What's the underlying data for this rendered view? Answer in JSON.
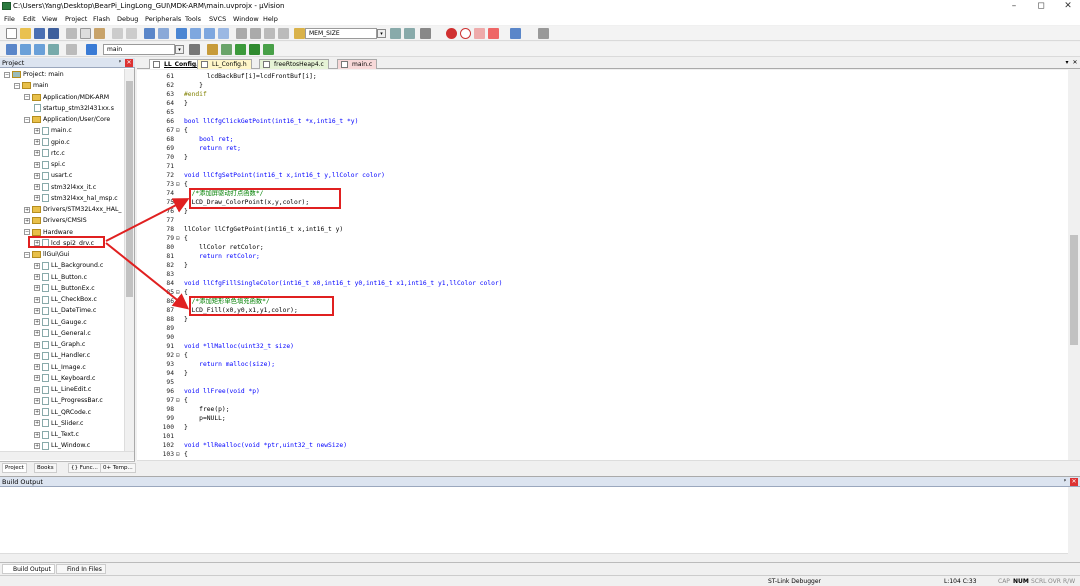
{
  "window": {
    "title": "C:\\Users\\Yang\\Desktop\\BearPi_LingLong_GUI\\MDK-ARM\\main.uvprojx - µVision",
    "minimize": "–",
    "maximize": "◻",
    "close": "✕"
  },
  "menu": [
    "File",
    "Edit",
    "View",
    "Project",
    "Flash",
    "Debug",
    "Peripherals",
    "Tools",
    "SVCS",
    "Window",
    "Help"
  ],
  "toolbar": {
    "find_combo": "MEM_SIZE",
    "target_combo": "main"
  },
  "project_panel": {
    "title": "Project",
    "close": "✕",
    "pin": "ᵖ",
    "items": [
      {
        "label": "Project: main",
        "indent": 0,
        "type": "root",
        "exp": "⊟"
      },
      {
        "label": "main",
        "indent": 1,
        "type": "target",
        "exp": "⊟"
      },
      {
        "label": "Application/MDK-ARM",
        "indent": 2,
        "type": "folder",
        "exp": "⊟"
      },
      {
        "label": "startup_stm32l431xx.s",
        "indent": 3,
        "type": "file",
        "exp": ""
      },
      {
        "label": "Application/User/Core",
        "indent": 2,
        "type": "folder",
        "exp": "⊟"
      },
      {
        "label": "main.c",
        "indent": 3,
        "type": "file",
        "exp": "⊞"
      },
      {
        "label": "gpio.c",
        "indent": 3,
        "type": "file",
        "exp": "⊞"
      },
      {
        "label": "rtc.c",
        "indent": 3,
        "type": "file",
        "exp": "⊞"
      },
      {
        "label": "spi.c",
        "indent": 3,
        "type": "file",
        "exp": "⊞"
      },
      {
        "label": "usart.c",
        "indent": 3,
        "type": "file",
        "exp": "⊞"
      },
      {
        "label": "stm32l4xx_it.c",
        "indent": 3,
        "type": "file",
        "exp": "⊞"
      },
      {
        "label": "stm32l4xx_hal_msp.c",
        "indent": 3,
        "type": "file",
        "exp": "⊞"
      },
      {
        "label": "Drivers/STM32L4xx_HAL_",
        "indent": 2,
        "type": "folder",
        "exp": "⊞"
      },
      {
        "label": "Drivers/CMSIS",
        "indent": 2,
        "type": "folder",
        "exp": "⊞"
      },
      {
        "label": "Hardware",
        "indent": 2,
        "type": "folder",
        "exp": "⊟"
      },
      {
        "label": "lcd_spi2_drv.c",
        "indent": 3,
        "type": "file",
        "exp": "⊞"
      },
      {
        "label": "llGui\\Gui",
        "indent": 2,
        "type": "folder",
        "exp": "⊟"
      },
      {
        "label": "LL_Background.c",
        "indent": 3,
        "type": "file",
        "exp": "⊞"
      },
      {
        "label": "LL_Button.c",
        "indent": 3,
        "type": "file",
        "exp": "⊞"
      },
      {
        "label": "LL_ButtonEx.c",
        "indent": 3,
        "type": "file",
        "exp": "⊞"
      },
      {
        "label": "LL_CheckBox.c",
        "indent": 3,
        "type": "file",
        "exp": "⊞"
      },
      {
        "label": "LL_DateTime.c",
        "indent": 3,
        "type": "file",
        "exp": "⊞"
      },
      {
        "label": "LL_Gauge.c",
        "indent": 3,
        "type": "file",
        "exp": "⊞"
      },
      {
        "label": "LL_General.c",
        "indent": 3,
        "type": "file",
        "exp": "⊞"
      },
      {
        "label": "LL_Graph.c",
        "indent": 3,
        "type": "file",
        "exp": "⊞"
      },
      {
        "label": "LL_Handler.c",
        "indent": 3,
        "type": "file",
        "exp": "⊞"
      },
      {
        "label": "LL_Image.c",
        "indent": 3,
        "type": "file",
        "exp": "⊞"
      },
      {
        "label": "LL_Keyboard.c",
        "indent": 3,
        "type": "file",
        "exp": "⊞"
      },
      {
        "label": "LL_LineEdit.c",
        "indent": 3,
        "type": "file",
        "exp": "⊞"
      },
      {
        "label": "LL_ProgressBar.c",
        "indent": 3,
        "type": "file",
        "exp": "⊞"
      },
      {
        "label": "LL_QRCode.c",
        "indent": 3,
        "type": "file",
        "exp": "⊞"
      },
      {
        "label": "LL_Slider.c",
        "indent": 3,
        "type": "file",
        "exp": "⊞"
      },
      {
        "label": "LL_Text.c",
        "indent": 3,
        "type": "file",
        "exp": "⊞"
      },
      {
        "label": "LL_Window.c",
        "indent": 3,
        "type": "file",
        "exp": "⊞"
      }
    ],
    "bottom_tabs": [
      "Project",
      "Books",
      "{} Func...",
      "0+ Temp..."
    ]
  },
  "editor_tabs": [
    {
      "label": "LL_Config.c",
      "active": true,
      "color": "#ffffff"
    },
    {
      "label": "LL_Config.h",
      "active": false,
      "color": "#fff6c8"
    },
    {
      "label": "freeRtosHeap4.c",
      "active": false,
      "color": "#e6f3d6"
    },
    {
      "label": "main.c",
      "active": false,
      "color": "#f7d8d8"
    }
  ],
  "code_lines": [
    {
      "n": "61",
      "f": "",
      "t": "      lcdBackBuf[i]=lcdFrontBuf[i];",
      "c": "n"
    },
    {
      "n": "62",
      "f": "",
      "t": "    }",
      "c": "n"
    },
    {
      "n": "63",
      "f": "",
      "t": "#endif",
      "c": "pp"
    },
    {
      "n": "64",
      "f": "",
      "t": "}",
      "c": "n"
    },
    {
      "n": "65",
      "f": "",
      "t": "",
      "c": "n"
    },
    {
      "n": "66",
      "f": "",
      "t": "bool llCfgClickGetPoint(int16_t *x,int16_t *y)",
      "c": "fn"
    },
    {
      "n": "67",
      "f": "⊟",
      "t": "{",
      "c": "n"
    },
    {
      "n": "68",
      "f": "",
      "t": "    bool ret;",
      "c": "kwl"
    },
    {
      "n": "69",
      "f": "",
      "t": "    return ret;",
      "c": "kwl"
    },
    {
      "n": "70",
      "f": "",
      "t": "}",
      "c": "n"
    },
    {
      "n": "71",
      "f": "",
      "t": "",
      "c": "n"
    },
    {
      "n": "72",
      "f": "",
      "t": "void llCfgSetPoint(int16_t x,int16_t y,llColor color)",
      "c": "fn"
    },
    {
      "n": "73",
      "f": "⊟",
      "t": "{",
      "c": "n"
    },
    {
      "n": "74",
      "f": "",
      "t": "  /*添加屏驱动打点函数*/",
      "c": "cm"
    },
    {
      "n": "75",
      "f": "",
      "t": "  LCD_Draw_ColorPoint(x,y,color);",
      "c": "n"
    },
    {
      "n": "76",
      "f": "",
      "t": "}",
      "c": "n"
    },
    {
      "n": "77",
      "f": "",
      "t": "",
      "c": "n"
    },
    {
      "n": "78",
      "f": "",
      "t": "llColor llCfgGetPoint(int16_t x,int16_t y)",
      "c": "n"
    },
    {
      "n": "79",
      "f": "⊟",
      "t": "{",
      "c": "n"
    },
    {
      "n": "80",
      "f": "",
      "t": "    llColor retColor;",
      "c": "n"
    },
    {
      "n": "81",
      "f": "",
      "t": "    return retColor;",
      "c": "kwl"
    },
    {
      "n": "82",
      "f": "",
      "t": "}",
      "c": "n"
    },
    {
      "n": "83",
      "f": "",
      "t": "",
      "c": "n"
    },
    {
      "n": "84",
      "f": "",
      "t": "void llCfgFillSingleColor(int16_t x0,int16_t y0,int16_t x1,int16_t y1,llColor color)",
      "c": "fn"
    },
    {
      "n": "85",
      "f": "⊟",
      "t": "{",
      "c": "n"
    },
    {
      "n": "86",
      "f": "",
      "t": "  /*添加矩形单色填充函数*/",
      "c": "cm"
    },
    {
      "n": "87",
      "f": "",
      "t": "  LCD_Fill(x0,y0,x1,y1,color);",
      "c": "n"
    },
    {
      "n": "88",
      "f": "",
      "t": "}",
      "c": "n"
    },
    {
      "n": "89",
      "f": "",
      "t": "",
      "c": "n"
    },
    {
      "n": "90",
      "f": "",
      "t": "",
      "c": "n"
    },
    {
      "n": "91",
      "f": "",
      "t": "void *llMalloc(uint32_t size)",
      "c": "fn"
    },
    {
      "n": "92",
      "f": "⊟",
      "t": "{",
      "c": "n"
    },
    {
      "n": "93",
      "f": "",
      "t": "    return malloc(size);",
      "c": "kwl"
    },
    {
      "n": "94",
      "f": "",
      "t": "}",
      "c": "n"
    },
    {
      "n": "95",
      "f": "",
      "t": "",
      "c": "n"
    },
    {
      "n": "96",
      "f": "",
      "t": "void llFree(void *p)",
      "c": "fn2"
    },
    {
      "n": "97",
      "f": "⊟",
      "t": "{",
      "c": "n"
    },
    {
      "n": "98",
      "f": "",
      "t": "    free(p);",
      "c": "n"
    },
    {
      "n": "99",
      "f": "",
      "t": "    p=NULL;",
      "c": "n"
    },
    {
      "n": "100",
      "f": "",
      "t": "}",
      "c": "n"
    },
    {
      "n": "101",
      "f": "",
      "t": "",
      "c": "n"
    },
    {
      "n": "102",
      "f": "",
      "t": "void *llRealloc(void *ptr,uint32_t newSize)",
      "c": "fn2"
    },
    {
      "n": "103",
      "f": "⊟",
      "t": "{",
      "c": "n"
    }
  ],
  "build_output": {
    "title": "Build Output",
    "tabs": [
      "Build Output",
      "Find In Files"
    ]
  },
  "statusbar": {
    "debugger": "ST-Link Debugger",
    "position": "L:104 C:33",
    "cap": "CAP",
    "num": "NUM",
    "scrl": "SCRL",
    "ovr": "OVR",
    "rw": "R/W"
  },
  "colors": {
    "annotation": "#e02020",
    "panel_header": "#dce4f0",
    "keyword": "#0000ff",
    "comment": "#008000",
    "preproc": "#808000"
  }
}
